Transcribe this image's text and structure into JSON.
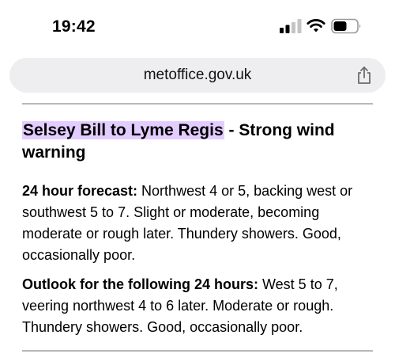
{
  "status_bar": {
    "time": "19:42",
    "icons": [
      "signal-icon",
      "wifi-icon",
      "battery-icon"
    ]
  },
  "browser": {
    "url": "metoffice.gov.uk",
    "share_icon": "share-icon",
    "url_bar_color": "#eeeef0"
  },
  "content": {
    "heading_highlighted": "Selsey Bill to Lyme Regis",
    "heading_rest": " - Strong wind warning",
    "highlight_color": "#e3ccff",
    "forecast_label": "24 hour forecast:",
    "forecast_text": " Northwest 4 or 5, backing west or southwest 5 to 7. Slight or moderate, becoming moderate or rough later. Thundery showers. Good, occasionally poor.",
    "outlook_label": "Outlook for the following 24 hours:",
    "outlook_text": " West 5 to 7, veering northwest 4 to 6 later. Moderate or rough. Thundery showers. Good, occasionally poor."
  }
}
